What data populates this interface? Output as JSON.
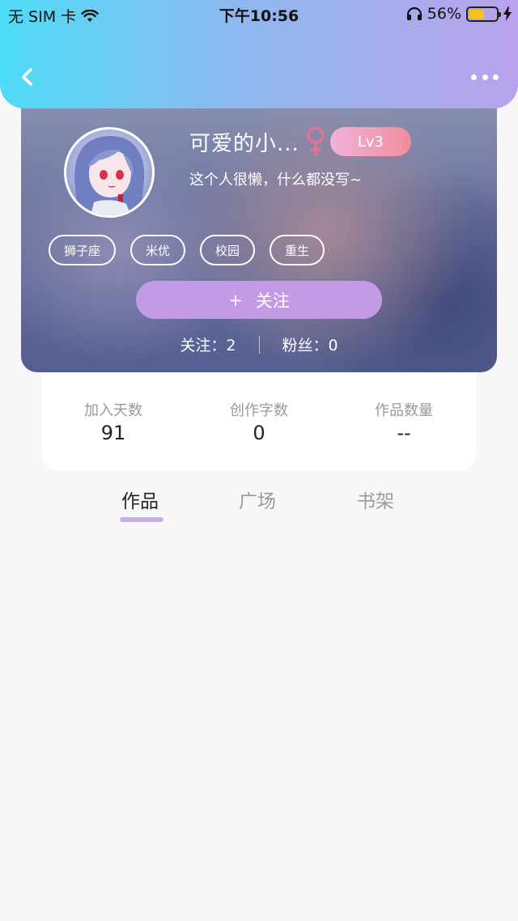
{
  "status_bar": {
    "carrier": "无 SIM 卡",
    "time": "下午10:56",
    "battery_percent": "56%",
    "battery_level": 0.56,
    "wifi_icon": "wifi-icon",
    "headphones_icon": "headphones-icon",
    "charging_icon": "bolt-icon"
  },
  "nav": {
    "back_icon": "chevron-left-icon",
    "more_icon": "more-dots-icon"
  },
  "profile": {
    "nickname": "可爱的小...",
    "gender_symbol": "♀",
    "gender_color": "#e5719a",
    "level": "Lv3",
    "bio": "这个人很懒，什么都没写~",
    "tags": [
      "狮子座",
      "米优",
      "校园",
      "重生"
    ],
    "follow_button": {
      "icon": "+",
      "label": "关注"
    },
    "following_label": "关注：",
    "following_count": "2",
    "followers_label": "粉丝：",
    "followers_count": "0"
  },
  "stats": [
    {
      "label": "加入天数",
      "value": "91"
    },
    {
      "label": "创作字数",
      "value": "0"
    },
    {
      "label": "作品数量",
      "value": "--"
    }
  ],
  "tabs": [
    {
      "label": "作品",
      "active": true
    },
    {
      "label": "广场",
      "active": false
    },
    {
      "label": "书架",
      "active": false
    }
  ],
  "colors": {
    "header_gradient_start": "#4ddcf7",
    "header_gradient_end": "#b9a2ec",
    "accent_purple": "#c39ae6",
    "tab_indicator": "#c8b0e9"
  }
}
